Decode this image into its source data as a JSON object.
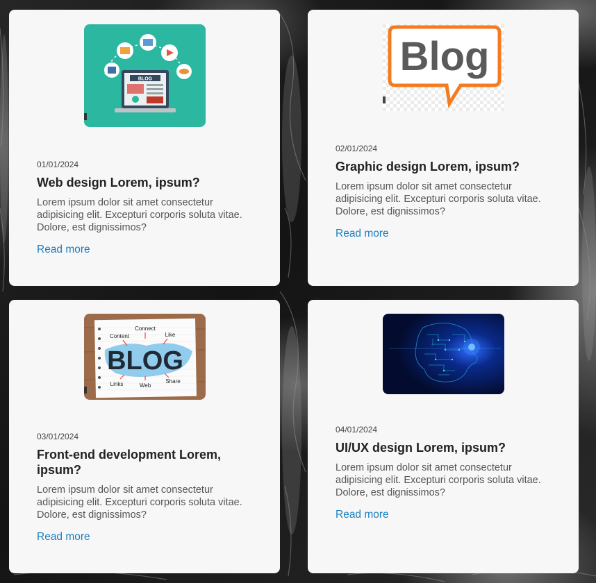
{
  "cards": [
    {
      "date": "01/01/2024",
      "title": "Web design Lorem, ipsum?",
      "description": "Lorem ipsum dolor sit amet consectetur adipisicing elit. Excepturi corporis soluta vitae. Dolore, est dignissimos?",
      "link": "Read more",
      "image_label": "BLOG"
    },
    {
      "date": "02/01/2024",
      "title": "Graphic design Lorem, ipsum?",
      "description": "Lorem ipsum dolor sit amet consectetur adipisicing elit. Excepturi corporis soluta vitae. Dolore, est dignissimos?",
      "link": "Read more",
      "image_label": "Blog"
    },
    {
      "date": "03/01/2024",
      "title": "Front-end development Lorem, ipsum?",
      "description": "Lorem ipsum dolor sit amet consectetur adipisicing elit. Excepturi corporis soluta vitae. Dolore, est dignissimos?",
      "link": "Read more",
      "image_label": "BLOG",
      "image_words": [
        "Content",
        "Connect",
        "Like",
        "Links",
        "Web",
        "Share"
      ]
    },
    {
      "date": "04/01/2024",
      "title": "UI/UX design Lorem, ipsum?",
      "description": "Lorem ipsum dolor sit amet consectetur adipisicing elit. Excepturi corporis soluta vitae. Dolore, est dignissimos?",
      "link": "Read more"
    }
  ],
  "colors": {
    "link": "#1a7fc1",
    "card_bg": "#f7f7f7",
    "blog_orange": "#f47b20",
    "teal": "#2bb7a0"
  }
}
